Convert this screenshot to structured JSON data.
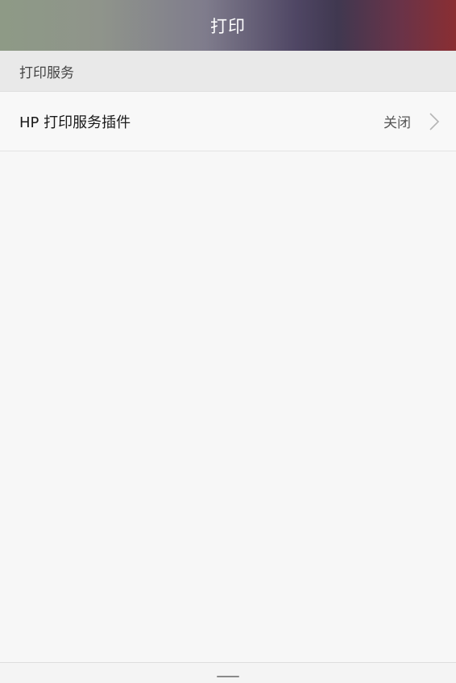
{
  "header": {
    "title": "打印"
  },
  "section": {
    "label": "打印服务"
  },
  "services": [
    {
      "label": "HP 打印服务插件",
      "status": "关闭",
      "icon": "chevron-right-icon"
    }
  ],
  "bottom_bar": {
    "icon": "drag-handle-icon"
  }
}
